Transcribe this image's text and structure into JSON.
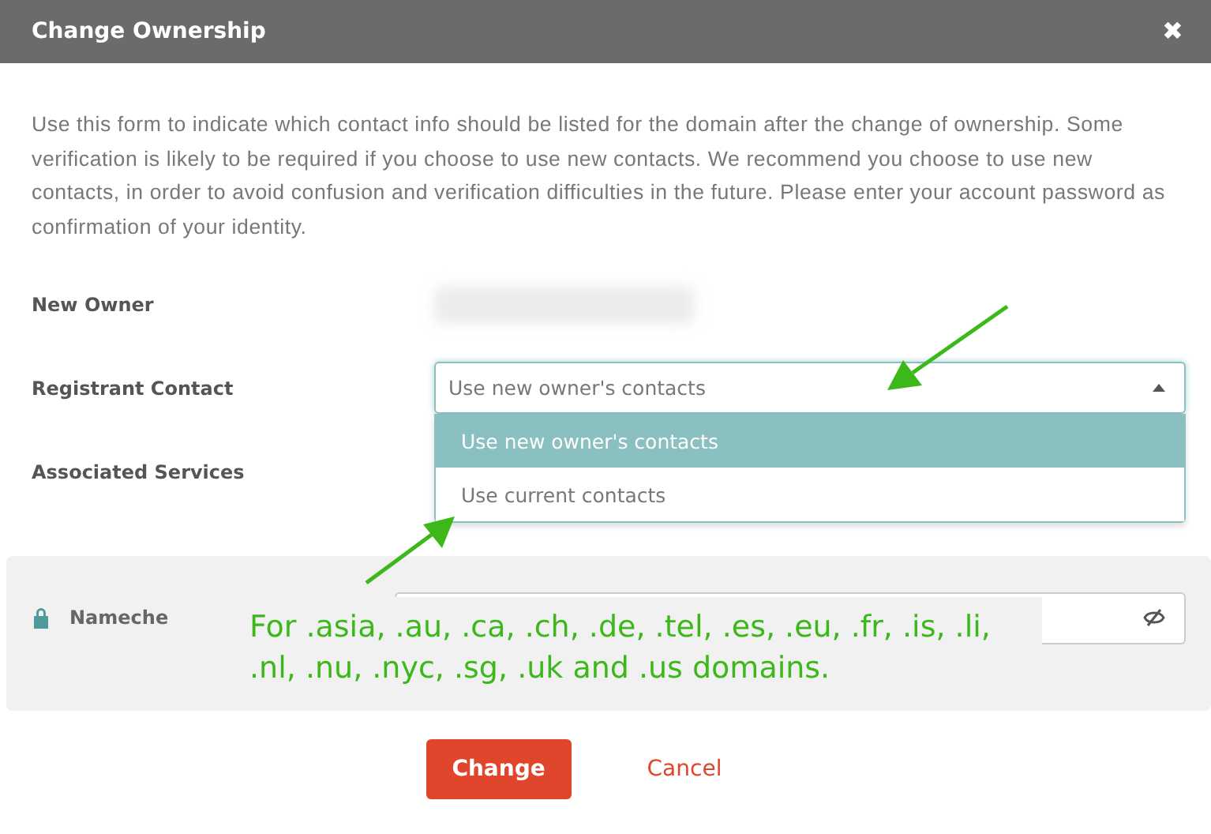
{
  "dialog": {
    "title": "Change Ownership",
    "close": "✖"
  },
  "intro": "Use this form to indicate which contact info should be listed for the domain after the change of ownership. Some verification is likely to be required if you choose to use new contacts. We recommend you choose to use new contacts, in order to avoid confusion and verification difficulties in the future. Please enter your account password as confirmation of your identity.",
  "new_owner": {
    "label": "New Owner"
  },
  "registrant": {
    "label": "Registrant Contact",
    "value": "Use new owner's contacts",
    "expanded": true,
    "options": [
      {
        "label": "Use new owner's contacts",
        "selected": true
      },
      {
        "label": "Use current contacts",
        "selected": false
      }
    ]
  },
  "associated": {
    "label": "Associated Services"
  },
  "password": {
    "label": "Nameche"
  },
  "annotation": {
    "lines": [
      "For .asia, .au, .ca, .ch, .de, .tel, .es, .eu, .fr, .is, .li,",
      ".nl, .nu, .nyc, .sg, .uk and .us domains."
    ]
  },
  "buttons": {
    "submit": "Change",
    "cancel": "Cancel"
  }
}
